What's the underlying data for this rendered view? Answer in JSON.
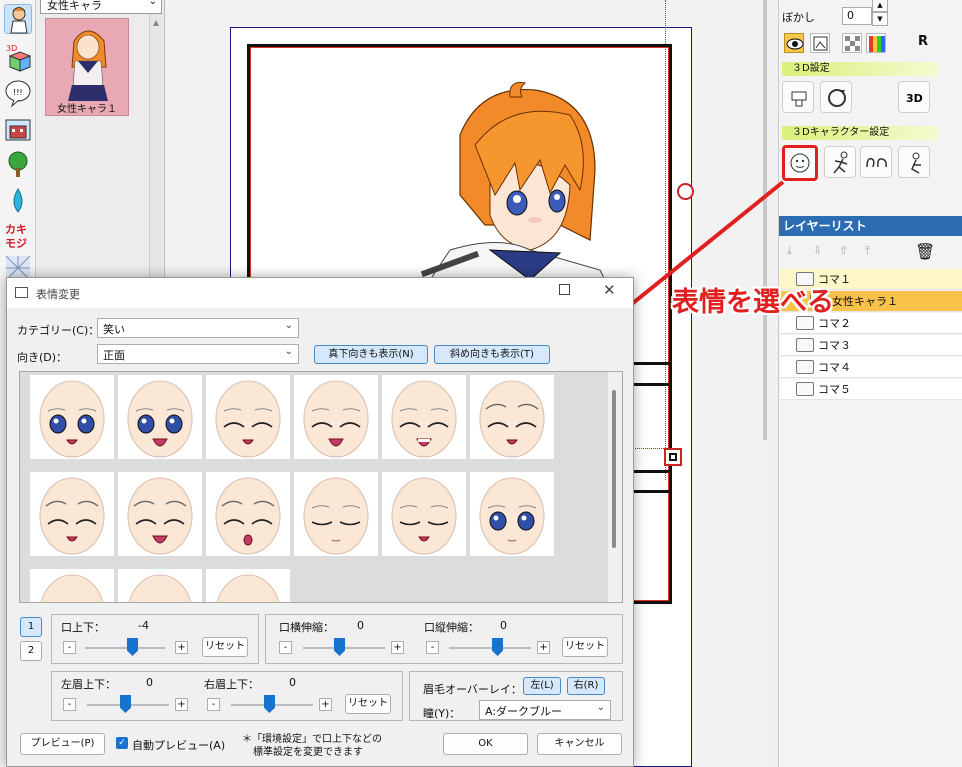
{
  "material_panel": {
    "category_value": "女性キャラ",
    "thumbnail_label": "女性キャラ１"
  },
  "top_right": {
    "blur_label": "ぼかし",
    "blur_value": "0"
  },
  "sections": {
    "settings_3d": "３D設定",
    "character_settings_3d": "３Dキャラクター設定"
  },
  "layer_list": {
    "title": "レイヤーリスト",
    "rows": [
      {
        "label": "コマ１"
      },
      {
        "label": "女性キャラ１"
      },
      {
        "label": "コマ２"
      },
      {
        "label": "コマ３"
      },
      {
        "label": "コマ４"
      },
      {
        "label": "コマ５"
      }
    ]
  },
  "annotation": {
    "text": "表情を選べる",
    "color": "#e0201f"
  },
  "dialog": {
    "title": "表情変更",
    "category_label": "カテゴリー(C)：",
    "category_value": "笑い",
    "direction_label": "向き(D)：",
    "direction_value": "正面",
    "show_vertical_button": "真下向きも表示(N)",
    "show_diagonal_button": "斜め向きも表示(T)",
    "faces": [
      {
        "expression": "open-eyes-smile",
        "eye_color": "blue"
      },
      {
        "expression": "open-eyes-big-smile",
        "eye_color": "blue"
      },
      {
        "expression": "closed-eyes-smile"
      },
      {
        "expression": "closed-eyes-open-mouth"
      },
      {
        "expression": "closed-eyes-laugh-teeth"
      },
      {
        "expression": "closed-eyes-brows-up"
      },
      {
        "expression": "closed-eyes-grin"
      },
      {
        "expression": "closed-eyes-laugh"
      },
      {
        "expression": "closed-eyes-o-mouth"
      },
      {
        "expression": "sleepy-closed-eyes"
      },
      {
        "expression": "sleepy-closed-eyes-smile"
      },
      {
        "expression": "open-eyes-neutral",
        "eye_color": "blue"
      }
    ],
    "page_buttons": [
      "1",
      "2"
    ],
    "mouth_vertical_label": "口上下：",
    "mouth_vertical_value": "-4",
    "mouth_width_label": "口横伸縮：",
    "mouth_width_value": "0",
    "mouth_height_label": "口縦伸縮：",
    "mouth_height_value": "0",
    "reset_label": "リセット",
    "left_brow_label": "左眉上下：",
    "left_brow_value": "0",
    "right_brow_label": "右眉上下：",
    "right_brow_value": "0",
    "brow_overlay_label": "眉毛オーバーレイ：",
    "brow_left_button": "左(L)",
    "brow_right_button": "右(R)",
    "pupil_label": "瞳(Y)：",
    "pupil_value": "A:ダークブルー",
    "preview_button": "プレビュー(P)",
    "auto_preview_label": "自動プレビュー(A)",
    "note_line1": "＊「環境設定」で口上下などの",
    "note_line2": "標準設定を変更できます",
    "ok_button": "OK",
    "cancel_button": "キャンセル",
    "minus": "-",
    "plus": "+"
  }
}
